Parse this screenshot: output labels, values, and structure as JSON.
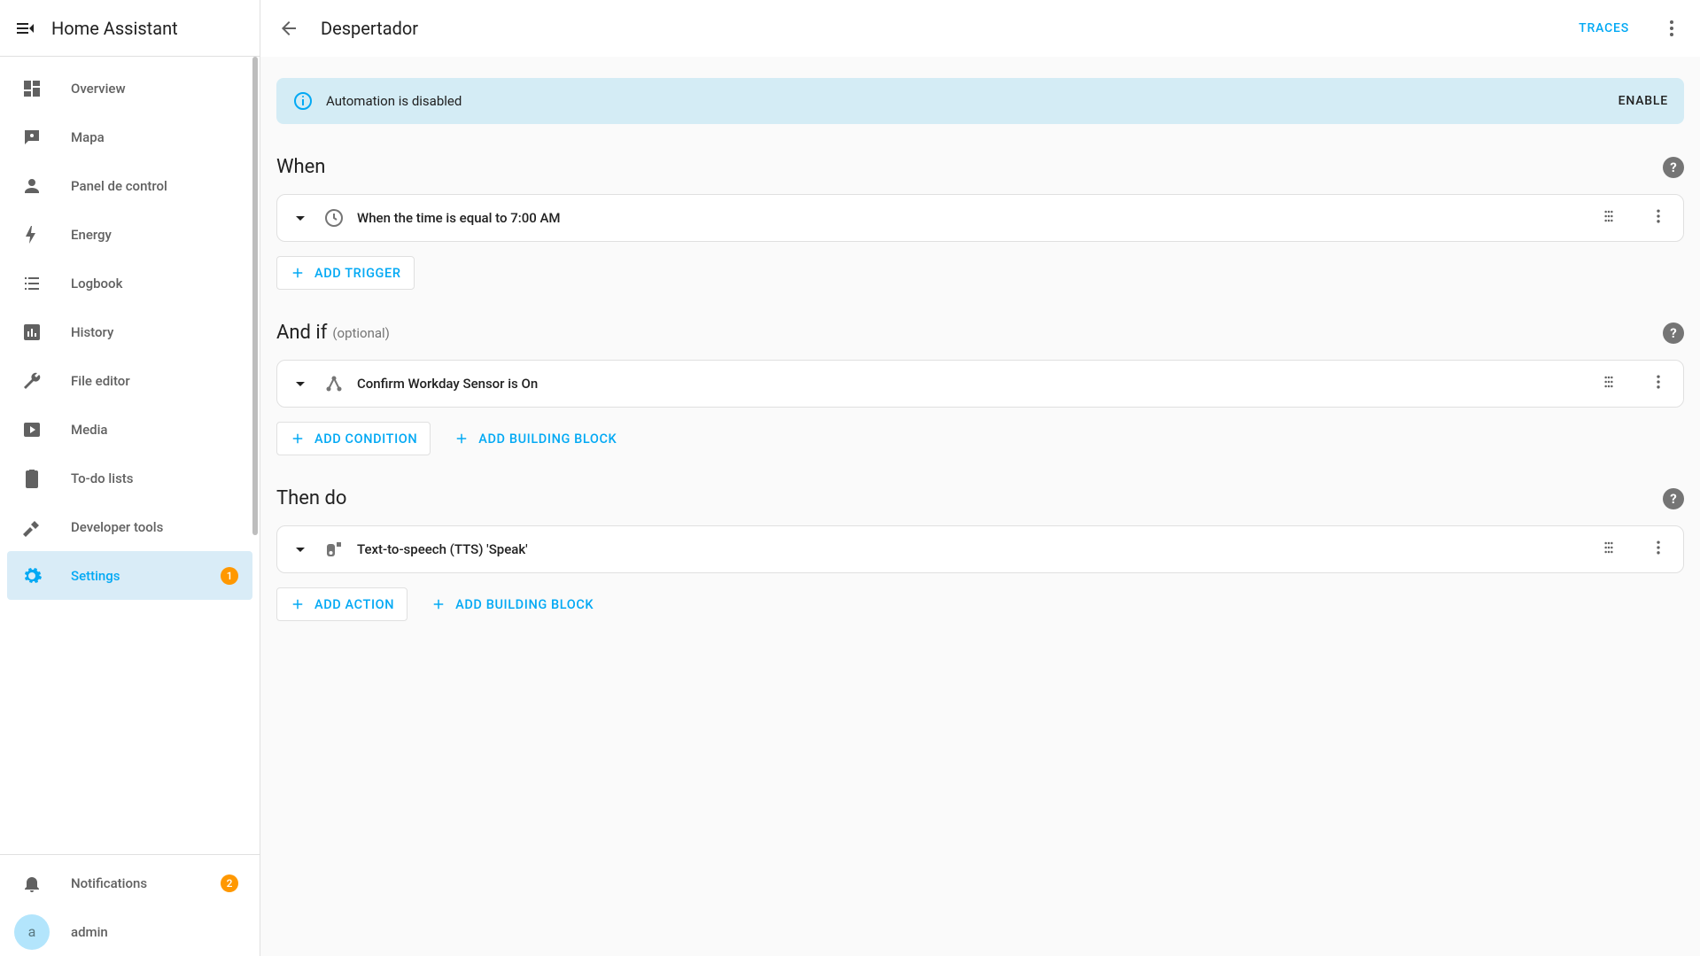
{
  "app": {
    "title": "Home Assistant"
  },
  "sidebar": {
    "items": [
      {
        "label": "Overview"
      },
      {
        "label": "Mapa"
      },
      {
        "label": "Panel de control"
      },
      {
        "label": "Energy"
      },
      {
        "label": "Logbook"
      },
      {
        "label": "History"
      },
      {
        "label": "File editor"
      },
      {
        "label": "Media"
      },
      {
        "label": "To-do lists"
      },
      {
        "label": "Developer tools"
      },
      {
        "label": "Settings",
        "badge": "1",
        "active": true
      }
    ],
    "notifications": {
      "label": "Notifications",
      "badge": "2"
    },
    "user": {
      "label": "admin",
      "avatar_letter": "a"
    }
  },
  "header": {
    "title": "Despertador",
    "traces": "TRACES"
  },
  "banner": {
    "text": "Automation is disabled",
    "enable": "ENABLE"
  },
  "sections": {
    "when": {
      "title": "When",
      "row": "When the time is equal to 7:00 AM",
      "add": "ADD TRIGGER"
    },
    "andif": {
      "title": "And if",
      "optional": "(optional)",
      "row": "Confirm Workday Sensor is On",
      "add_condition": "ADD CONDITION",
      "add_block": "ADD BUILDING BLOCK"
    },
    "thendo": {
      "title": "Then do",
      "row": "Text-to-speech (TTS) 'Speak'",
      "add_action": "ADD ACTION",
      "add_block": "ADD BUILDING BLOCK"
    }
  }
}
